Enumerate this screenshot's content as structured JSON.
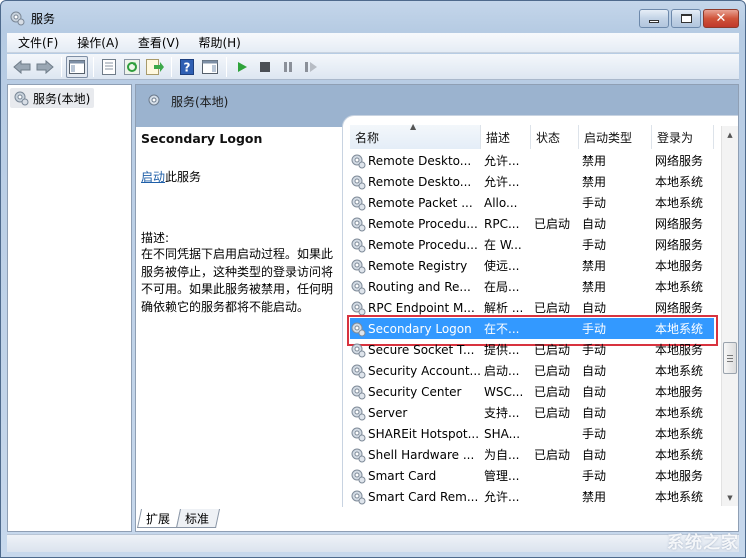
{
  "window": {
    "title": "服务",
    "controls": {
      "minimize": "minimize",
      "maximize": "maximize",
      "close": "close"
    }
  },
  "menubar": {
    "items": [
      {
        "label": "文件(F)"
      },
      {
        "label": "操作(A)"
      },
      {
        "label": "查看(V)"
      },
      {
        "label": "帮助(H)"
      }
    ]
  },
  "toolbar": {
    "buttons": [
      {
        "icon": "back-arrow-icon"
      },
      {
        "icon": "forward-arrow-icon"
      },
      {
        "icon": "show-hide-console-tree-icon",
        "active": true
      },
      {
        "icon": "properties-icon"
      },
      {
        "icon": "refresh-icon"
      },
      {
        "icon": "export-list-icon"
      },
      {
        "icon": "help-icon"
      },
      {
        "icon": "show-hide-action-pane-icon"
      },
      {
        "icon": "start-service-icon"
      },
      {
        "icon": "stop-service-icon"
      },
      {
        "icon": "pause-service-icon"
      },
      {
        "icon": "resume-service-icon"
      }
    ]
  },
  "tree": {
    "items": [
      {
        "label": "服务(本地)",
        "selected": true
      }
    ]
  },
  "main": {
    "header": "服务(本地)",
    "detail": {
      "service_name": "Secondary Logon",
      "action_link": "启动",
      "action_suffix": "此服务",
      "description_label": "描述:",
      "description": "在不同凭据下启用启动过程。如果此服务被停止，这种类型的登录访问将不可用。如果此服务被禁用，任何明确依赖它的服务都将不能启动。"
    },
    "list": {
      "columns": [
        "名称",
        "描述",
        "状态",
        "启动类型",
        "登录为"
      ],
      "sorted_column": "名称",
      "rows": [
        {
          "name": "Remote Deskto...",
          "desc": "允许...",
          "status": "",
          "startup": "禁用",
          "logon": "网络服务"
        },
        {
          "name": "Remote Deskto...",
          "desc": "允许...",
          "status": "",
          "startup": "禁用",
          "logon": "本地系统"
        },
        {
          "name": "Remote Packet ...",
          "desc": "Allo...",
          "status": "",
          "startup": "手动",
          "logon": "本地系统"
        },
        {
          "name": "Remote Procedu...",
          "desc": "RPC...",
          "status": "已启动",
          "startup": "自动",
          "logon": "网络服务"
        },
        {
          "name": "Remote Procedu...",
          "desc": "在 W...",
          "status": "",
          "startup": "手动",
          "logon": "网络服务"
        },
        {
          "name": "Remote Registry",
          "desc": "使远...",
          "status": "",
          "startup": "禁用",
          "logon": "本地服务"
        },
        {
          "name": "Routing and Re...",
          "desc": "在局...",
          "status": "",
          "startup": "禁用",
          "logon": "本地系统"
        },
        {
          "name": "RPC Endpoint M...",
          "desc": "解析 ...",
          "status": "已启动",
          "startup": "自动",
          "logon": "网络服务"
        },
        {
          "name": "Secondary Logon",
          "desc": "在不...",
          "status": "",
          "startup": "手动",
          "logon": "本地系统",
          "selected": true
        },
        {
          "name": "Secure Socket T...",
          "desc": "提供...",
          "status": "已启动",
          "startup": "手动",
          "logon": "本地服务"
        },
        {
          "name": "Security Account...",
          "desc": "启动...",
          "status": "已启动",
          "startup": "自动",
          "logon": "本地系统"
        },
        {
          "name": "Security Center",
          "desc": "WSC...",
          "status": "已启动",
          "startup": "自动",
          "logon": "本地服务"
        },
        {
          "name": "Server",
          "desc": "支持...",
          "status": "已启动",
          "startup": "自动",
          "logon": "本地系统"
        },
        {
          "name": "SHAREit Hotspot...",
          "desc": "SHA...",
          "status": "",
          "startup": "手动",
          "logon": "本地系统"
        },
        {
          "name": "Shell Hardware ...",
          "desc": "为自...",
          "status": "已启动",
          "startup": "自动",
          "logon": "本地系统"
        },
        {
          "name": "Smart Card",
          "desc": "管理...",
          "status": "",
          "startup": "手动",
          "logon": "本地服务"
        },
        {
          "name": "Smart Card Rem...",
          "desc": "允许...",
          "status": "",
          "startup": "禁用",
          "logon": "本地系统"
        }
      ]
    },
    "tabs": [
      {
        "label": "扩展",
        "active": true
      },
      {
        "label": "标准",
        "active": false
      }
    ]
  },
  "watermark": "系统之家",
  "colors": {
    "selection": "#3399ff",
    "highlight_box": "#d8333f",
    "link": "#1f5fa8",
    "header_band": "#9bb3cf",
    "annotation_arrow": "#e03a3a"
  }
}
